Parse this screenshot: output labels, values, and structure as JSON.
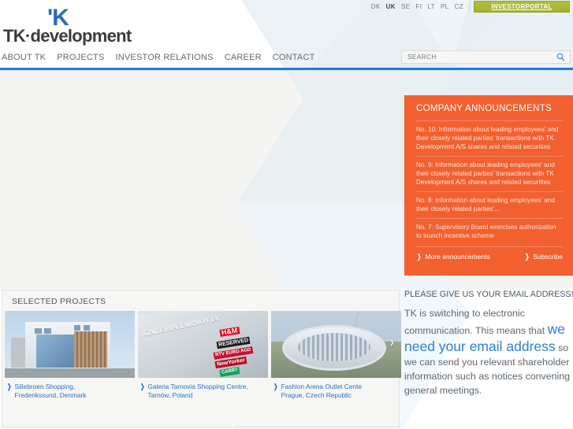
{
  "topbar": {
    "languages": [
      {
        "code": "DK",
        "active": false
      },
      {
        "code": "UK",
        "active": true
      },
      {
        "code": "SE",
        "active": false
      },
      {
        "code": "FI",
        "active": false
      },
      {
        "code": "LT",
        "active": false
      },
      {
        "code": "PL",
        "active": false
      },
      {
        "code": "CZ",
        "active": false
      }
    ],
    "investor_portal_label": "INVESTORPORTAL",
    "investor_portal_color": "#a8b534"
  },
  "logo": {
    "mark": "'K",
    "word": "TK·development",
    "mark_color": "#2b6cb8",
    "word_color": "#3c3c3c"
  },
  "nav": {
    "items": [
      {
        "label": "ABOUT TK"
      },
      {
        "label": "PROJECTS"
      },
      {
        "label": "INVESTOR RELATIONS"
      },
      {
        "label": "CAREER"
      },
      {
        "label": "CONTACT"
      }
    ]
  },
  "search": {
    "placeholder": "SEARCH",
    "value": "",
    "icon": "search-icon"
  },
  "announcements": {
    "title": "COMPANY ANNOUNCEMENTS",
    "accent_color": "#f2602f",
    "items": [
      {
        "text": "No. 10: Information about leading employees' and their closely related parties' transactions with TK Development A/S shares and related securities"
      },
      {
        "text": "No. 9: Information about leading employees' and their closely related parties' transactions with TK Development A/S shares and related securities"
      },
      {
        "text": "No. 8: Information about leading employees' and their closely related parties'..."
      },
      {
        "text": "No. 7: Supervisory Board exercises authorization to launch incentive scheme"
      }
    ],
    "more_label": "More announcements",
    "subscribe_label": "Subscribe"
  },
  "projects": {
    "title": "SELECTED PROJECTS",
    "next_label": "›",
    "cards": [
      {
        "caption": "Sillebroen Shopping,\nFrederikssund, Denmark",
        "image_alt": "sillebroen-shopping-building"
      },
      {
        "caption": "Galeria Tarnovia Shopping Centre,\nTarnów, Poland",
        "image_alt": "galeria-tarnovia-facade",
        "facade_text": "GALERIA TARNOVIA",
        "signs": [
          "H&M",
          "RESERVED",
          "RTV EURO AGD",
          "NewYorker",
          "CARRY"
        ]
      },
      {
        "caption": "Fashion Arena Outlet Cente\nPrague, Czech Republic",
        "image_alt": "fashion-arena-outlet-aerial"
      }
    ]
  },
  "promo": {
    "title": "PLEASE GIVE US YOUR EMAIL ADDRESS!",
    "text_before": "TK is switching to electronic communication. This means that ",
    "highlight": "we need your email address",
    "text_after": " so we can send you relevant shareholder information such as notices convening general meetings.",
    "highlight_color": "#2f7fd0"
  }
}
